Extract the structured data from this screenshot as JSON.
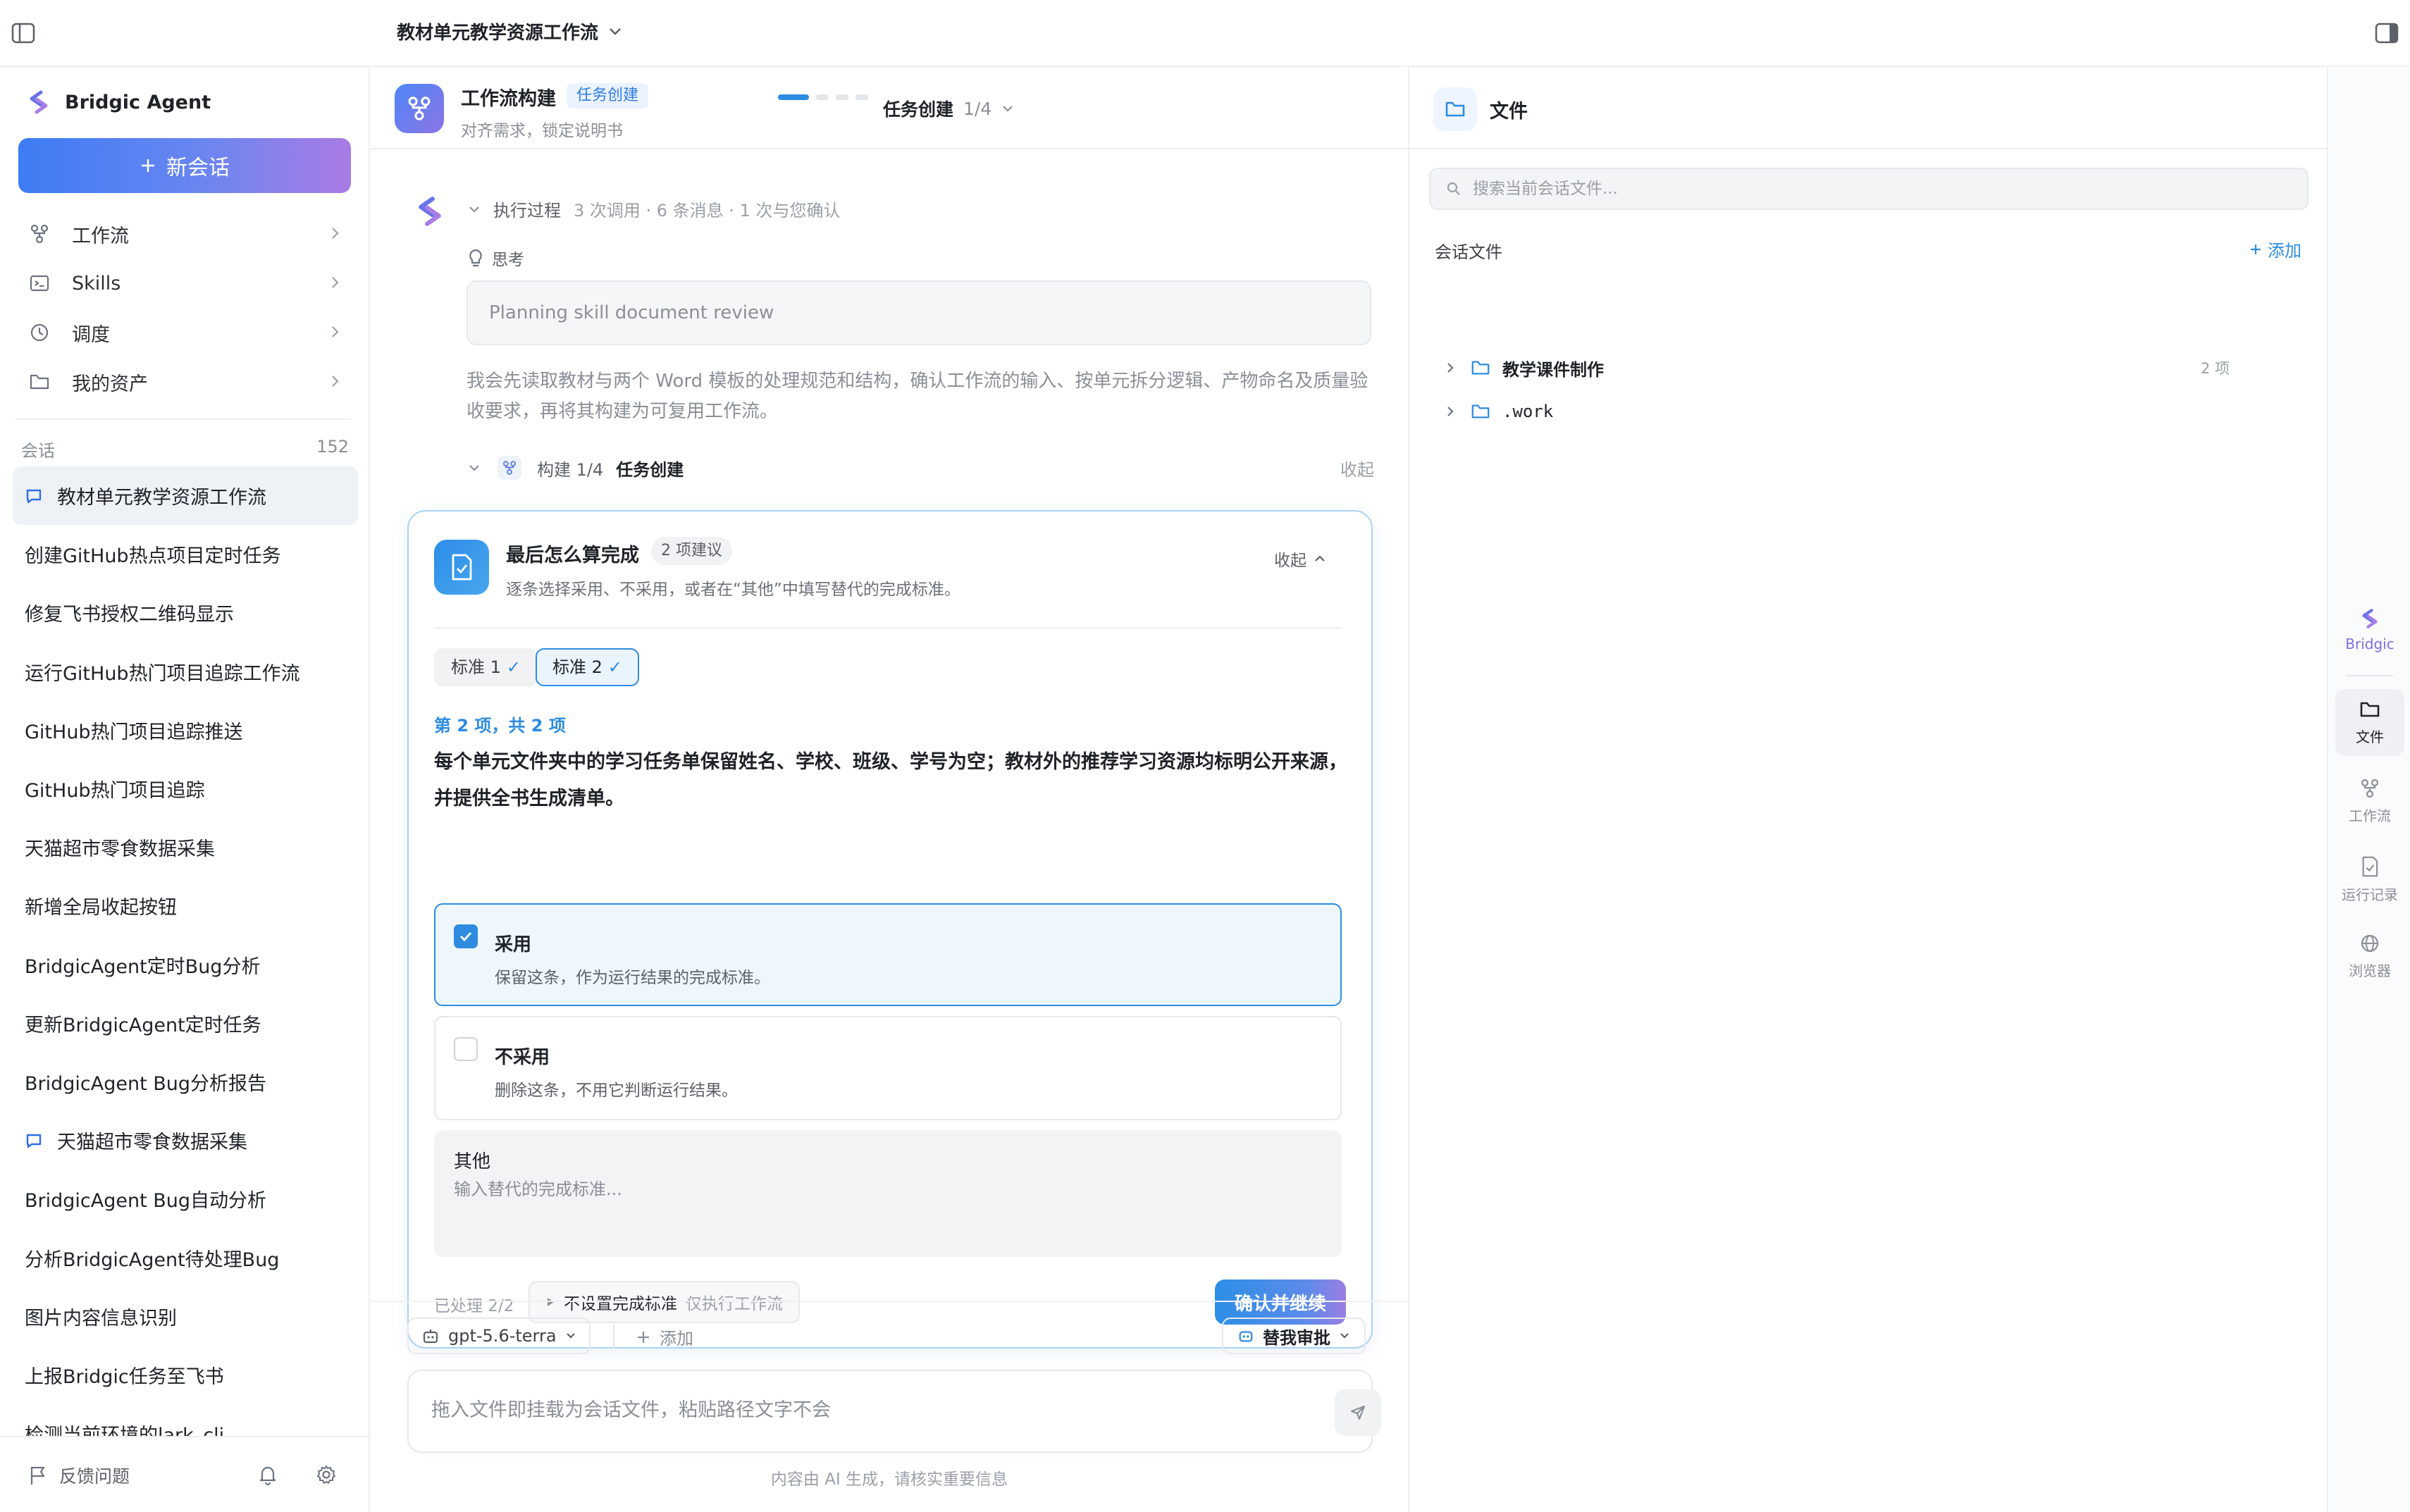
{
  "topbar": {
    "title": "教材单元教学资源工作流"
  },
  "sidebar": {
    "brand": "Bridgic Agent",
    "new_chat": "新会话",
    "nav": [
      {
        "label": "工作流",
        "icon": "workflow-icon"
      },
      {
        "label": "Skills",
        "icon": "terminal-icon"
      },
      {
        "label": "调度",
        "icon": "clock-icon"
      },
      {
        "label": "我的资产",
        "icon": "folder-icon"
      }
    ],
    "conversations_label": "会话",
    "conversations_count": "152",
    "conversations": [
      {
        "title": "教材单元教学资源工作流",
        "active": true,
        "icon": true
      },
      {
        "title": "创建GitHub热点项目定时任务"
      },
      {
        "title": "修复飞书授权二维码显示"
      },
      {
        "title": "运行GitHub热门项目追踪工作流"
      },
      {
        "title": "GitHub热门项目追踪推送"
      },
      {
        "title": "GitHub热门项目追踪"
      },
      {
        "title": "天猫超市零食数据采集"
      },
      {
        "title": "新增全局收起按钮"
      },
      {
        "title": "BridgicAgent定时Bug分析"
      },
      {
        "title": "更新BridgicAgent定时任务"
      },
      {
        "title": "BridgicAgent Bug分析报告"
      },
      {
        "title": "天猫超市零食数据采集",
        "icon": true
      },
      {
        "title": "BridgicAgent Bug自动分析"
      },
      {
        "title": "分析BridgicAgent待处理Bug"
      },
      {
        "title": "图片内容信息识别"
      },
      {
        "title": "上报Bridgic任务至飞书"
      },
      {
        "title": "检测当前环境的lark_cli"
      }
    ],
    "feedback": "反馈问题"
  },
  "workflow": {
    "title": "工作流构建",
    "badge": "任务创建",
    "subtitle": "对齐需求，锁定说明书",
    "progress": {
      "current": 1,
      "total": 4
    },
    "step_name": "任务创建",
    "step_count": "1/4"
  },
  "exec": {
    "label": "执行过程",
    "meta": "3 次调用 · 6 条消息 · 1 次与您确认",
    "think_label": "思考",
    "think_summary": "Planning skill document review",
    "think_text": "我会先读取教材与两个 Word 模板的处理规范和结构，确认工作流的输入、按单元拆分逻辑、产物命名及质量验收要求，再将其构建为可复用工作流。",
    "build_step": "构建 1/4",
    "build_name": "任务创建",
    "build_collapse": "收起"
  },
  "card": {
    "title": "最后怎么算完成",
    "badge": "2 项建议",
    "desc": "逐条选择采用、不采用，或者在“其他”中填写替代的完成标准。",
    "collapse": "收起",
    "tabs": [
      {
        "label": "标准 1",
        "check": "✓"
      },
      {
        "label": "标准 2",
        "check": "✓"
      }
    ],
    "item_count": "第 2 项，共 2 项",
    "item_text": "每个单元文件夹中的学习任务单保留姓名、学校、班级、学号为空；教材外的推荐学习资源均标明公开来源，并提供全书生成清单。",
    "options": {
      "adopt": {
        "title": "采用",
        "desc": "保留这条，作为运行结果的完成标准。",
        "checked": true
      },
      "reject": {
        "title": "不采用",
        "desc": "删除这条，不用它判断运行结果。",
        "checked": false
      },
      "other": {
        "title": "其他",
        "placeholder": "输入替代的完成标准..."
      }
    },
    "processed": "已处理 2/2",
    "skip_label": "不设置完成标准",
    "skip_sub": "仅执行工作流",
    "confirm": "确认并继续"
  },
  "composer": {
    "model": "gpt-5.6-terra",
    "add": "添加",
    "approval": "替我审批",
    "placeholder": "拖入文件即挂载为会话文件，粘贴路径文字不会",
    "disclaimer": "内容由 AI 生成，请核实重要信息"
  },
  "files": {
    "title": "文件",
    "search_placeholder": "搜索当前会话文件...",
    "section": "会话文件",
    "add": "添加",
    "tree": [
      {
        "name": "教学课件制作",
        "count": "2 项"
      },
      {
        "name": ".work",
        "count": ""
      }
    ]
  },
  "rail": {
    "bridgic": "Bridgic",
    "files": "文件",
    "workflow": "工作流",
    "runs": "运行记录",
    "browser": "浏览器"
  },
  "colors": {
    "accent": "#2d8ce0",
    "brand_gradient_start": "#3d7cf5",
    "brand_gradient_end": "#a97be4"
  }
}
